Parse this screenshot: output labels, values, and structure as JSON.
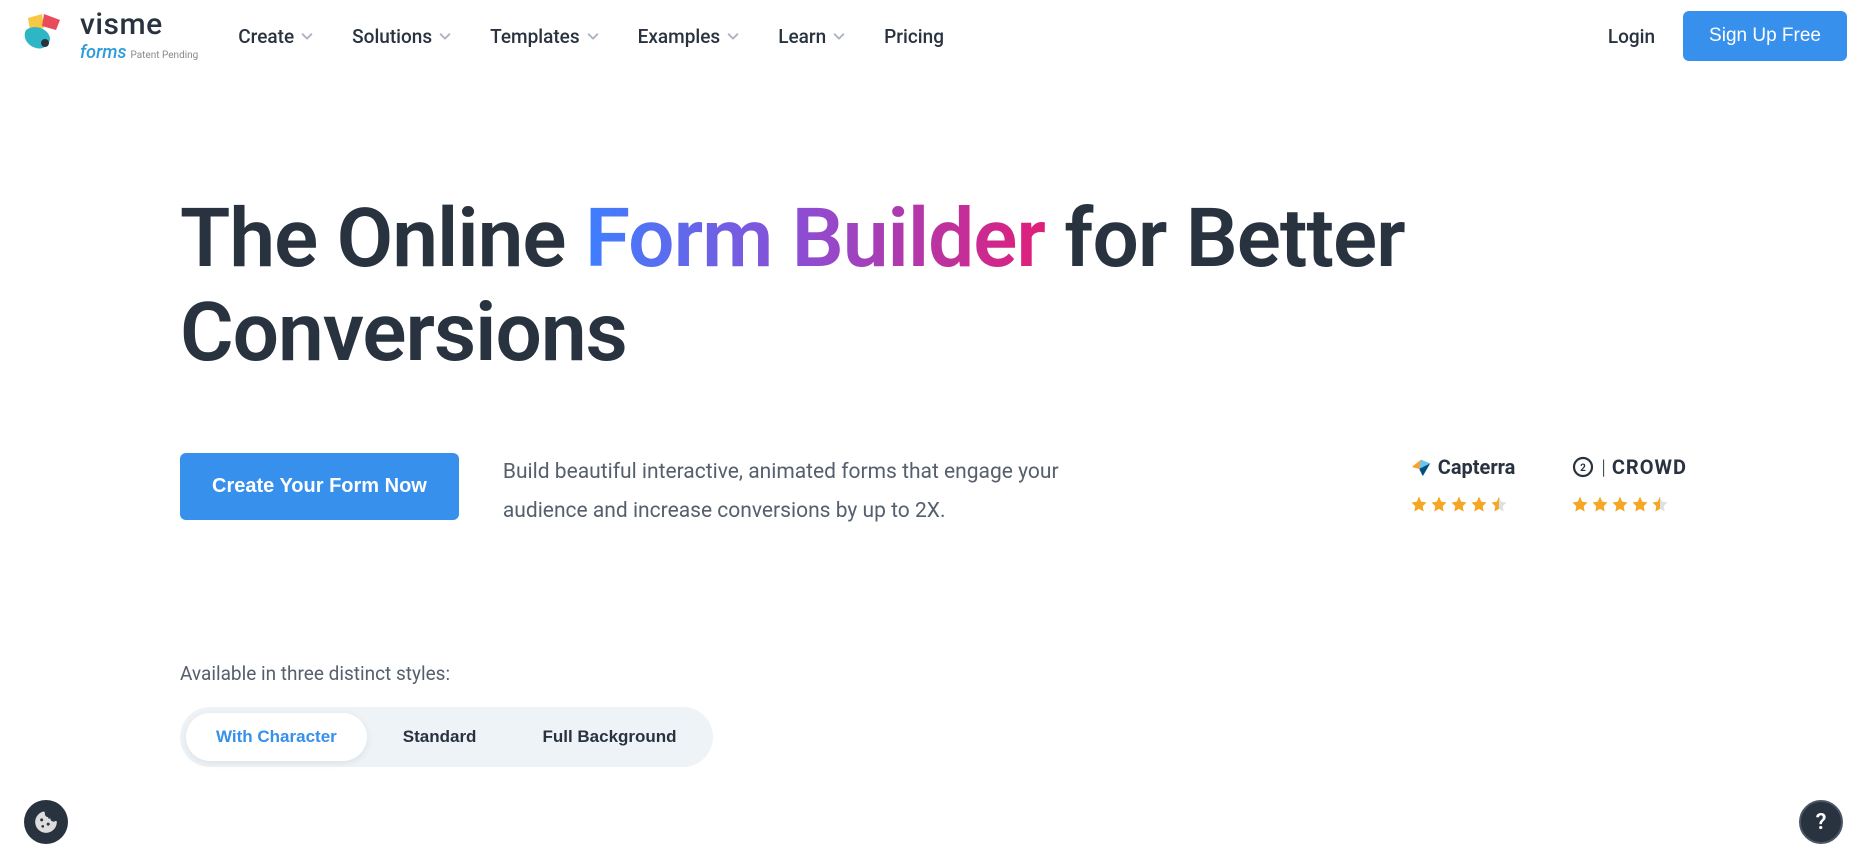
{
  "logo": {
    "word": "visme",
    "sub": "forms",
    "patent": "Patent Pending"
  },
  "nav": {
    "items": [
      {
        "label": "Create",
        "dropdown": true
      },
      {
        "label": "Solutions",
        "dropdown": true
      },
      {
        "label": "Templates",
        "dropdown": true
      },
      {
        "label": "Examples",
        "dropdown": true
      },
      {
        "label": "Learn",
        "dropdown": true
      },
      {
        "label": "Pricing",
        "dropdown": false
      }
    ]
  },
  "auth": {
    "login": "Login",
    "signup": "Sign Up Free"
  },
  "hero": {
    "title_pre": "The Online ",
    "title_gradient": "Form Builder",
    "title_post": " for Better Conversions",
    "cta": "Create Your Form Now",
    "description": "Build beautiful interactive, animated forms that engage your audience and increase conversions by up to 2X."
  },
  "ratings": [
    {
      "brand": "Capterra",
      "stars": 4.5
    },
    {
      "brand": "CROWD",
      "prefix": "G2",
      "stars": 4.5
    }
  ],
  "styles": {
    "label": "Available in three distinct styles:",
    "tabs": [
      {
        "label": "With Character",
        "active": true
      },
      {
        "label": "Standard",
        "active": false
      },
      {
        "label": "Full Background",
        "active": false
      }
    ]
  },
  "help": {
    "icon": "?"
  }
}
